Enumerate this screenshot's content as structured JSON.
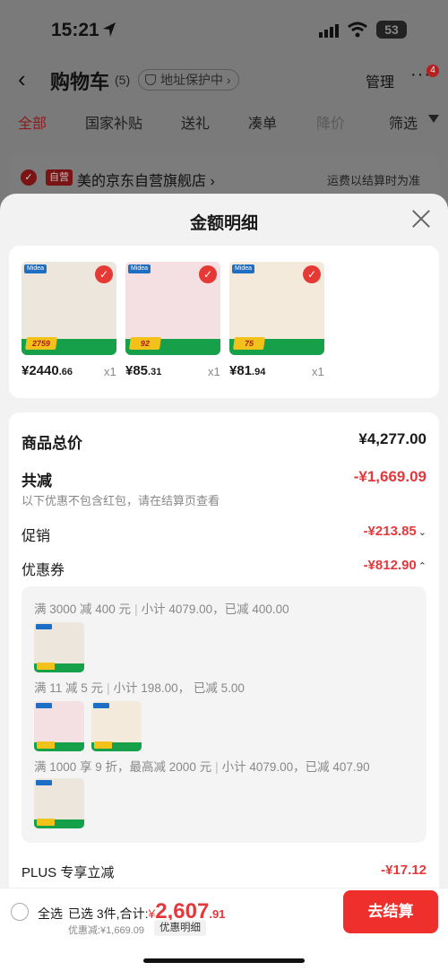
{
  "status_bar": {
    "time": "15:21",
    "battery": "53"
  },
  "nav": {
    "title": "购物车",
    "count": "(5)",
    "address_protection": "地址保护中",
    "address_protection_chevron": "›",
    "manage": "管理",
    "more": "···",
    "more_badge": "4"
  },
  "tabs": [
    "全部",
    "国家补贴",
    "送礼",
    "凑单",
    "降价",
    "筛选"
  ],
  "store": {
    "self_tag": "自营",
    "name": "美的京东自营旗舰店",
    "chevron": "›",
    "shipping_note": "运费以结算时为准"
  },
  "sheet": {
    "title": "金额明细",
    "products": [
      {
        "price_int": "¥2440",
        "price_dec": ".66",
        "qty": "x1",
        "brand": "Midea",
        "badge_price": "2759"
      },
      {
        "price_int": "¥85",
        "price_dec": ".31",
        "qty": "x1",
        "brand": "Midea",
        "badge_price": "92"
      },
      {
        "price_int": "¥81",
        "price_dec": ".94",
        "qty": "x1",
        "brand": "Midea",
        "badge_price": "75"
      }
    ],
    "summary": {
      "goods_total_label": "商品总价",
      "goods_total_value": "¥4,277.00",
      "total_discount_label": "共减",
      "total_discount_value": "-¥1,669.09",
      "note": "以下优惠不包含红包，请在结算页查看",
      "promo_label": "促销",
      "promo_value": "-¥213.85",
      "promo_chevron": "⌄",
      "coupon_label": "优惠券",
      "coupon_value": "-¥812.90",
      "coupon_chevron": "⌃",
      "coupon_items": [
        {
          "rule": "满 3000 减 400 元",
          "detail": "小计 4079.00，已减 400.00"
        },
        {
          "rule": "满 11 减 5 元",
          "detail": "小计 198.00，  已减 5.00"
        },
        {
          "rule": "满 1000 享 9 折，最高减 2000 元",
          "detail": "小计 4079.00，已减 407.90"
        }
      ],
      "plus_label": "PLUS 专享立减",
      "plus_value": "-¥17.12"
    }
  },
  "bottom_bar": {
    "select_all": "全选",
    "selected_text": "已选 3件,合计:",
    "currency": "¥",
    "total_int": "2,607",
    "total_dec": ".91",
    "discount_text": "优惠减:¥1,669.09",
    "detail_chip": "优惠明细",
    "checkout": "去结算"
  },
  "colors": {
    "accent_red": "#e4393c",
    "checkout_red": "#ee2f2b"
  }
}
